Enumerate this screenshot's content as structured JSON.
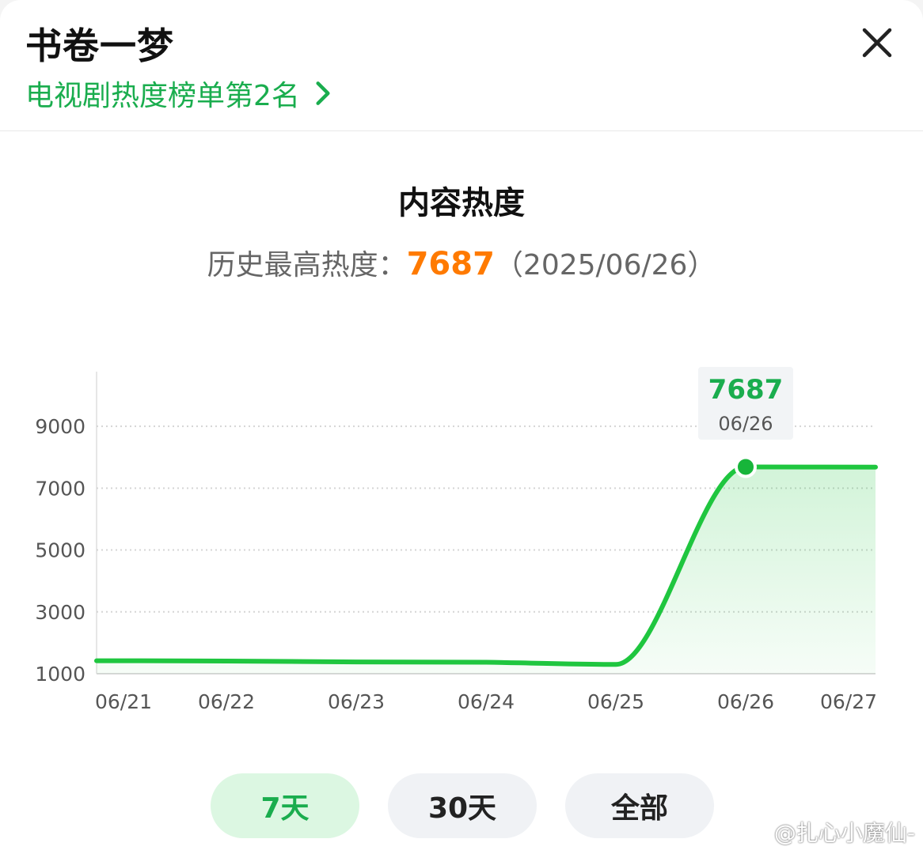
{
  "header": {
    "title": "书卷一梦",
    "rank_text": "电视剧热度榜单第2名"
  },
  "chart_header": {
    "title": "内容热度",
    "peak_label": "历史最高热度：",
    "peak_value": "7687",
    "peak_date": "（2025/06/26）"
  },
  "tooltip": {
    "value": "7687",
    "date": "06/26"
  },
  "tabs": [
    {
      "label": "7天",
      "active": true
    },
    {
      "label": "30天",
      "active": false
    },
    {
      "label": "全部",
      "active": false
    }
  ],
  "watermark": {
    "text": "@扎心小魔仙-"
  },
  "colors": {
    "accent": "#1aad4e",
    "line": "#1fc63f",
    "peak": "#ff7a00"
  },
  "chart_data": {
    "type": "area",
    "x": [
      "06/21",
      "06/22",
      "06/23",
      "06/24",
      "06/25",
      "06/26",
      "06/27"
    ],
    "y_ticks": [
      1000,
      3000,
      5000,
      7000,
      9000
    ],
    "ylim": [
      1000,
      10000
    ],
    "grid": true,
    "series": [
      {
        "values": [
          1420,
          1410,
          1380,
          1370,
          1300,
          7687,
          7680
        ]
      }
    ],
    "highlight": {
      "x": "06/26",
      "y": 7687
    }
  }
}
